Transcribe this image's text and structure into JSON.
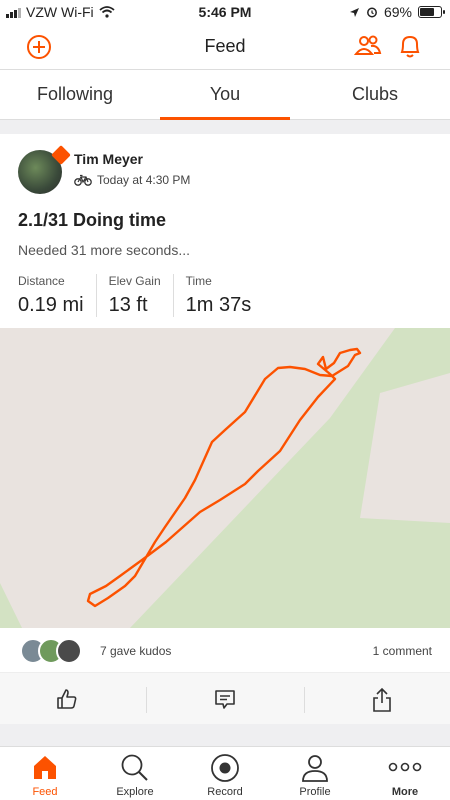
{
  "status": {
    "carrier": "VZW Wi-Fi",
    "time": "5:46 PM",
    "battery": "69%"
  },
  "header": {
    "title": "Feed"
  },
  "tabs": [
    {
      "label": "Following",
      "active": false
    },
    {
      "label": "You",
      "active": true
    },
    {
      "label": "Clubs",
      "active": false
    }
  ],
  "activity": {
    "athlete": "Tim Meyer",
    "time": "Today at 4:30 PM",
    "title": "2.1/31 Doing time",
    "description": "Needed 31 more seconds...",
    "stats": [
      {
        "label": "Distance",
        "value": "0.19 mi"
      },
      {
        "label": "Elev Gain",
        "value": "13 ft"
      },
      {
        "label": "Time",
        "value": "1m 37s"
      }
    ],
    "kudos": "7 gave kudos",
    "comments": "1 comment"
  },
  "nav": [
    {
      "label": "Feed",
      "icon": "home-icon",
      "active": true
    },
    {
      "label": "Explore",
      "icon": "search-icon",
      "active": false
    },
    {
      "label": "Record",
      "icon": "record-icon",
      "active": false
    },
    {
      "label": "Profile",
      "icon": "profile-icon",
      "active": false
    },
    {
      "label": "More",
      "icon": "more-icon",
      "active": false
    }
  ],
  "colors": {
    "accent": "#fc5200",
    "map_land": "#e9e3df",
    "map_park": "#d3e2c3"
  }
}
